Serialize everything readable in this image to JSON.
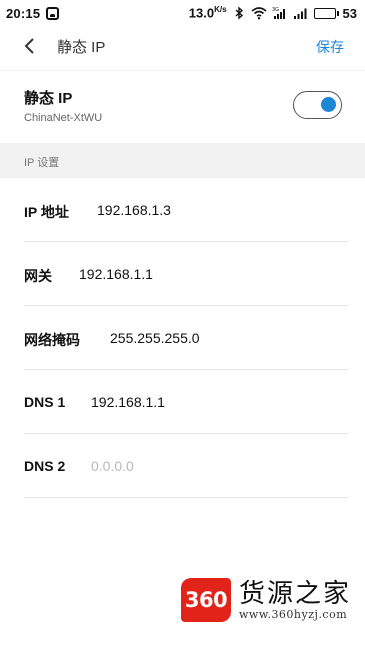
{
  "status_bar": {
    "time": "20:15",
    "net_speed": "13.0",
    "net_speed_unit": "K/s",
    "battery_level": "53",
    "battery_color": "#3bb54a"
  },
  "header": {
    "title": "静态 IP",
    "save_label": "保存",
    "accent_color": "#1e86d6"
  },
  "static_ip": {
    "label": "静态 IP",
    "network": "ChinaNet-XtWU",
    "enabled": true
  },
  "section": {
    "label": "IP 设置"
  },
  "fields": [
    {
      "name": "IP 地址",
      "value": "192.168.1.3",
      "placeholder": false
    },
    {
      "name": "网关",
      "value": "192.168.1.1",
      "placeholder": false
    },
    {
      "name": "网络掩码",
      "value": "255.255.255.0",
      "placeholder": false
    },
    {
      "name": "DNS 1",
      "value": "192.168.1.1",
      "placeholder": false
    },
    {
      "name": "DNS 2",
      "value": "0.0.0.0",
      "placeholder": true
    }
  ],
  "watermark": {
    "logo_text": "360",
    "name": "货源之家",
    "url": "www.360hyzj.com"
  }
}
